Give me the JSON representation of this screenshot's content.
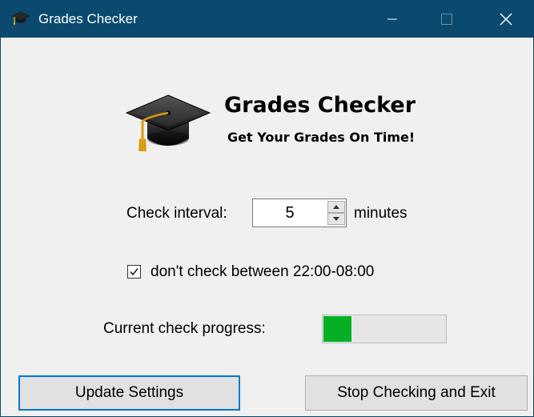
{
  "window": {
    "title": "Grades Checker",
    "icon": "graduation-cap-icon",
    "titlebar_color": "#0b4a6e"
  },
  "header": {
    "logo": "graduation-cap-icon",
    "title": "Grades Checker",
    "subtitle": "Get Your Grades On Time!"
  },
  "settings": {
    "interval_label": "Check interval:",
    "interval_value": "5",
    "interval_unit": "minutes",
    "quiet_hours_checked": true,
    "quiet_hours_label": "don't check between 22:00-08:00"
  },
  "progress": {
    "label": "Current check progress:",
    "value_fraction": 0.23,
    "color": "#06b025"
  },
  "buttons": {
    "update": "Update Settings",
    "stop": "Stop Checking and Exit"
  }
}
